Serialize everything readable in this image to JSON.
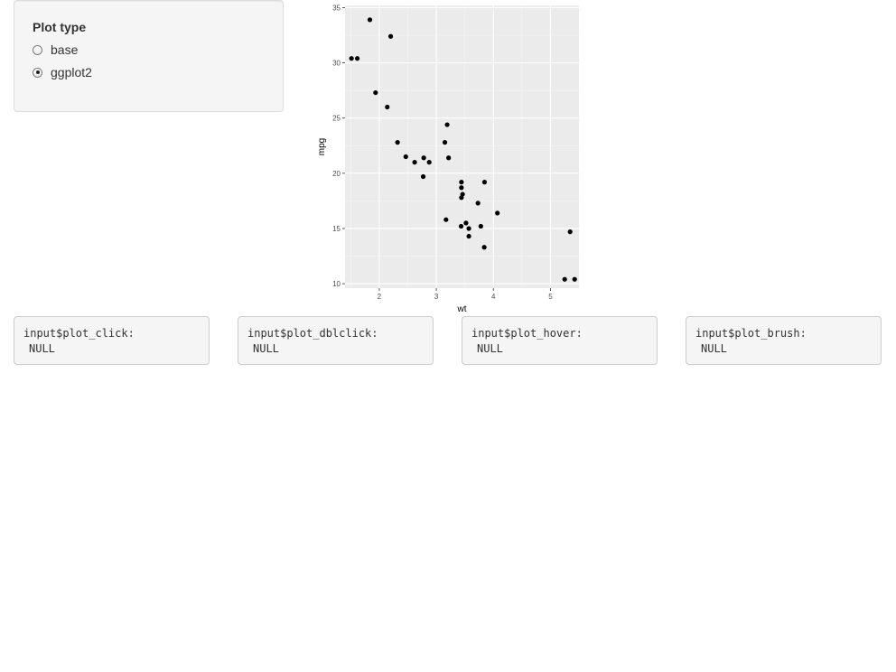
{
  "sidebar": {
    "title": "Plot type",
    "options": [
      {
        "label": "base",
        "selected": false
      },
      {
        "label": "ggplot2",
        "selected": true
      }
    ]
  },
  "outputs": [
    {
      "label": "input$plot_click:",
      "value": "NULL"
    },
    {
      "label": "input$plot_dblclick:",
      "value": "NULL"
    },
    {
      "label": "input$plot_hover:",
      "value": "NULL"
    },
    {
      "label": "input$plot_brush:",
      "value": "NULL"
    }
  ],
  "chart_data": {
    "type": "scatter",
    "title": "",
    "xlabel": "wt",
    "ylabel": "mpg",
    "xlim": [
      1.4,
      5.5
    ],
    "ylim": [
      9.6,
      35.2
    ],
    "xticks": [
      2,
      3,
      4,
      5
    ],
    "yticks": [
      10,
      15,
      20,
      25,
      30,
      35
    ],
    "grid": true,
    "background": "#ebebeb",
    "point_color": "#000000",
    "points": [
      {
        "x": 2.62,
        "y": 21.0
      },
      {
        "x": 2.875,
        "y": 21.0
      },
      {
        "x": 2.32,
        "y": 22.8
      },
      {
        "x": 3.215,
        "y": 21.4
      },
      {
        "x": 3.44,
        "y": 18.7
      },
      {
        "x": 3.46,
        "y": 18.1
      },
      {
        "x": 3.57,
        "y": 14.3
      },
      {
        "x": 3.19,
        "y": 24.4
      },
      {
        "x": 3.15,
        "y": 22.8
      },
      {
        "x": 3.44,
        "y": 19.2
      },
      {
        "x": 3.44,
        "y": 17.8
      },
      {
        "x": 4.07,
        "y": 16.4
      },
      {
        "x": 3.73,
        "y": 17.3
      },
      {
        "x": 3.78,
        "y": 15.2
      },
      {
        "x": 5.25,
        "y": 10.4
      },
      {
        "x": 5.424,
        "y": 10.4
      },
      {
        "x": 5.345,
        "y": 14.7
      },
      {
        "x": 2.2,
        "y": 32.4
      },
      {
        "x": 1.615,
        "y": 30.4
      },
      {
        "x": 1.835,
        "y": 33.9
      },
      {
        "x": 2.465,
        "y": 21.5
      },
      {
        "x": 3.52,
        "y": 15.5
      },
      {
        "x": 3.435,
        "y": 15.2
      },
      {
        "x": 3.84,
        "y": 13.3
      },
      {
        "x": 3.845,
        "y": 19.2
      },
      {
        "x": 1.935,
        "y": 27.3
      },
      {
        "x": 2.14,
        "y": 26.0
      },
      {
        "x": 1.513,
        "y": 30.4
      },
      {
        "x": 3.17,
        "y": 15.8
      },
      {
        "x": 2.77,
        "y": 19.7
      },
      {
        "x": 3.57,
        "y": 15.0
      },
      {
        "x": 2.78,
        "y": 21.4
      }
    ]
  }
}
